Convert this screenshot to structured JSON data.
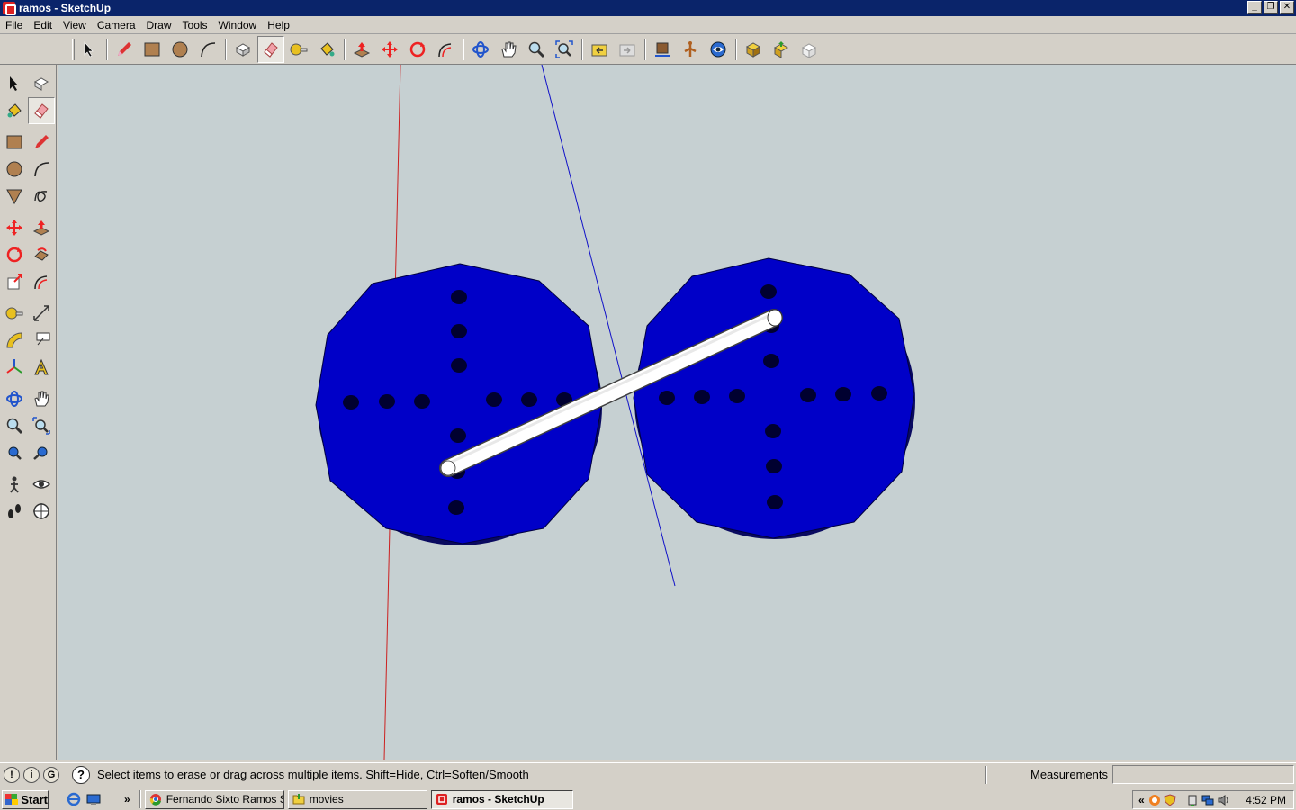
{
  "window": {
    "title": "ramos - SketchUp",
    "minimize": "_",
    "restore": "❐",
    "close": "✕"
  },
  "menu": [
    {
      "label": "File"
    },
    {
      "label": "Edit"
    },
    {
      "label": "View"
    },
    {
      "label": "Camera"
    },
    {
      "label": "Draw"
    },
    {
      "label": "Tools"
    },
    {
      "label": "Window"
    },
    {
      "label": "Help"
    }
  ],
  "toolbar": {
    "tools": [
      "select-icon",
      "pencil-icon",
      "rectangle-icon",
      "circle-icon",
      "arc-icon",
      "make-component-icon",
      "eraser-icon",
      "tape-measure-icon",
      "paint-bucket-icon",
      "push-pull-icon",
      "move-icon",
      "rotate-icon",
      "offset-icon",
      "orbit-icon",
      "pan-icon",
      "zoom-icon",
      "zoom-extents-icon",
      "previous-view-icon",
      "next-view-icon",
      "position-camera-icon",
      "walk-icon",
      "look-around-icon",
      "get-models-icon",
      "share-model-icon",
      "share-component-icon"
    ],
    "active": "eraser-icon"
  },
  "viewport": {
    "background": "#c6d0d2",
    "disc_color": "#0000c8",
    "axis_red": "#cc2020",
    "axis_blue": "#1010c8"
  },
  "status": {
    "help_glyph": "?",
    "message": "Select items to erase or drag across multiple items. Shift=Hide, Ctrl=Soften/Smooth",
    "measurements_label": "Measurements",
    "measurements_value": ""
  },
  "taskbar": {
    "start": "Start",
    "overflow": "»",
    "tasks": [
      {
        "label": "Fernando Sixto Ramos S..."
      },
      {
        "label": "movies"
      },
      {
        "label": "ramos - SketchUp"
      }
    ],
    "tray_arrow": "«",
    "clock": "4:52 PM"
  }
}
